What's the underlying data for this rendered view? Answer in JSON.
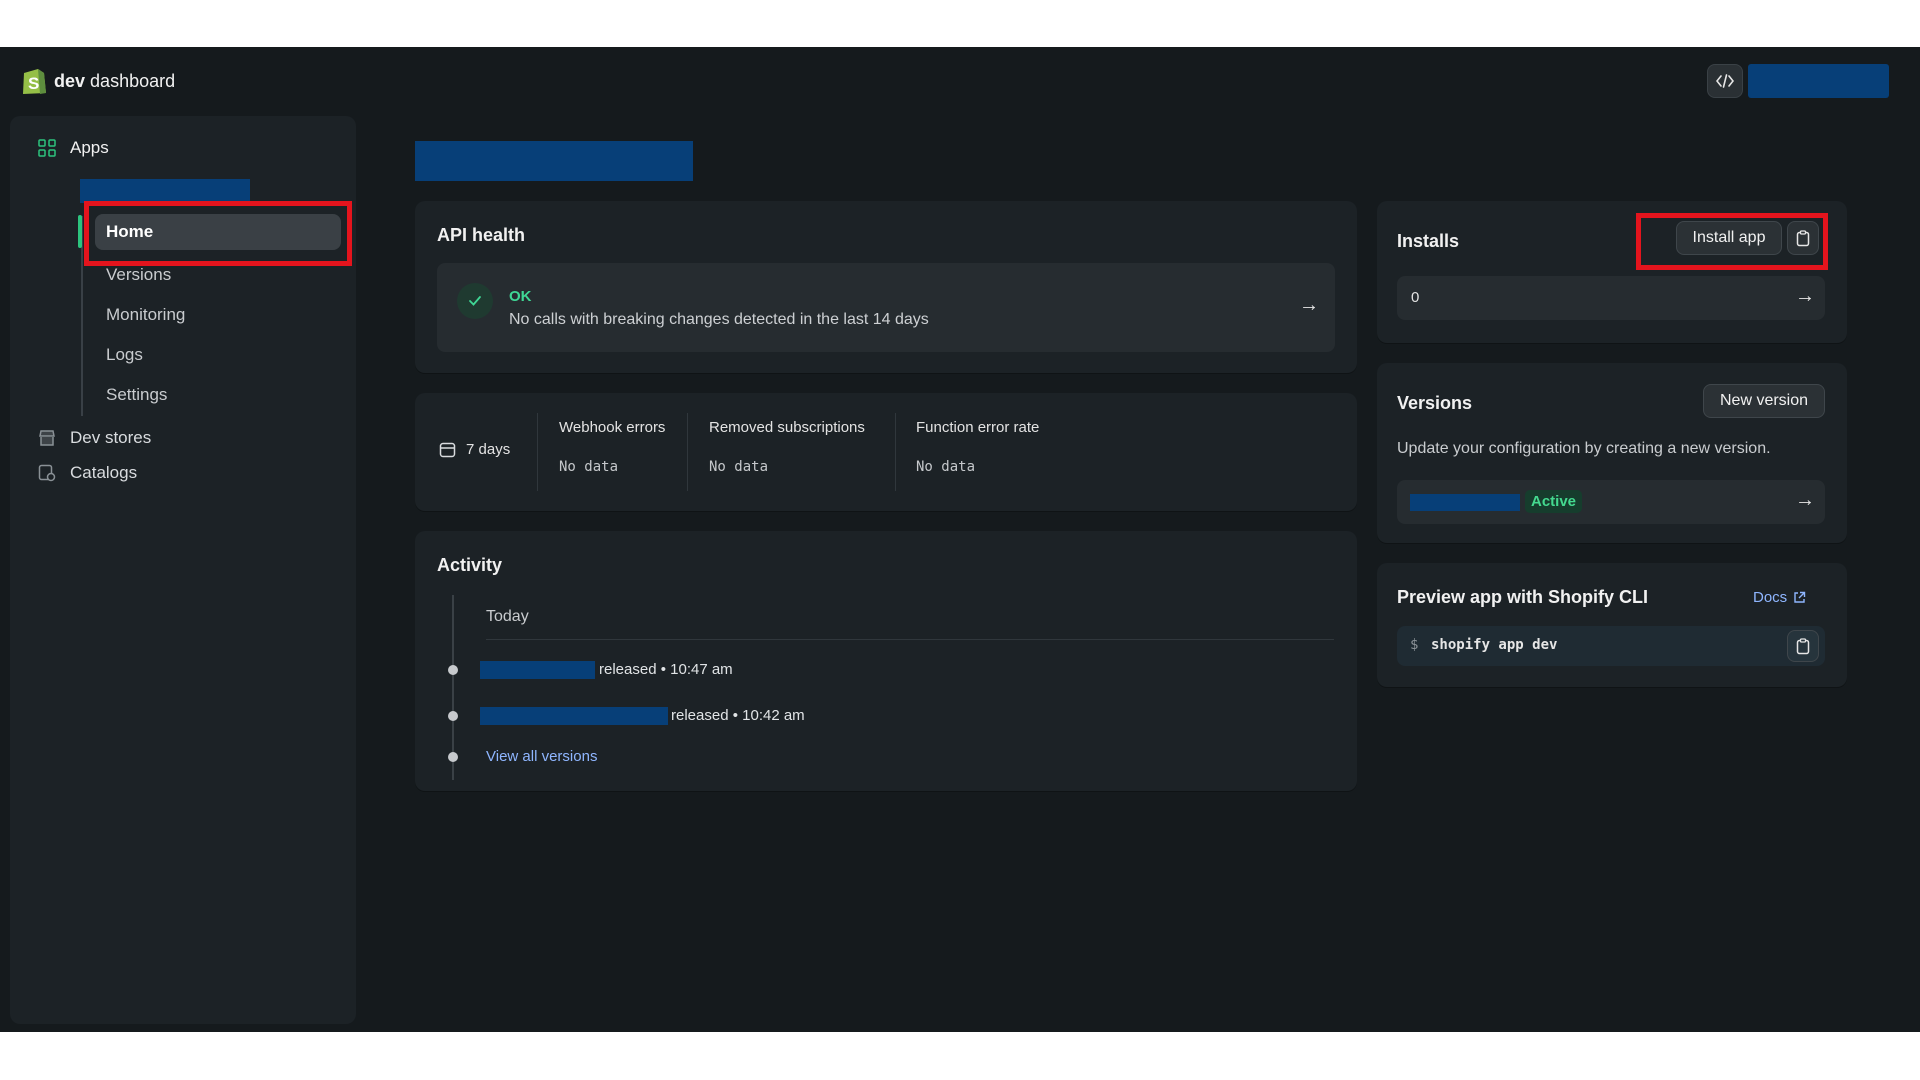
{
  "header": {
    "brand_bold": "dev",
    "brand_rest": "dashboard",
    "code_icon": "code-icon"
  },
  "sidebar": {
    "apps_label": "Apps",
    "subitems": [
      "Home",
      "Versions",
      "Monitoring",
      "Logs",
      "Settings"
    ],
    "active": "Home",
    "dev_stores": "Dev stores",
    "catalogs": "Catalogs"
  },
  "api_health": {
    "title": "API health",
    "status": "OK",
    "message": "No calls with breaking changes detected in the last 14 days"
  },
  "metrics": {
    "period": "7 days",
    "items": [
      {
        "label": "Webhook errors",
        "value": "No data"
      },
      {
        "label": "Removed subscriptions",
        "value": "No data"
      },
      {
        "label": "Function error rate",
        "value": "No data"
      }
    ]
  },
  "activity": {
    "title": "Activity",
    "group": "Today",
    "entries": [
      {
        "action": "released",
        "time": "• 10:47 am"
      },
      {
        "action": "released",
        "time": "• 10:42 am"
      }
    ],
    "view_all": "View all versions"
  },
  "installs": {
    "title": "Installs",
    "install_button": "Install app",
    "count": "0"
  },
  "versions": {
    "title": "Versions",
    "new_button": "New version",
    "description": "Update your configuration by creating a new version.",
    "status": "Active"
  },
  "preview": {
    "title": "Preview app with Shopify CLI",
    "docs": "Docs",
    "prompt": "$",
    "command": "shopify app dev"
  },
  "colors": {
    "background": "#151a1d",
    "card": "#1c2226",
    "accent_green": "#3fd795",
    "redaction": "#073f78",
    "highlight": "#e4141d",
    "link": "#8fb6ff"
  }
}
